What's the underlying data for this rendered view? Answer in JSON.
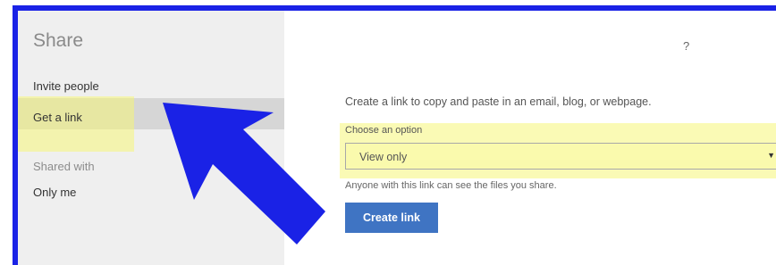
{
  "sidebar": {
    "title": "Share",
    "items": [
      {
        "label": "Invite people"
      },
      {
        "label": "Get a link"
      }
    ],
    "shared_with_label": "Shared with",
    "shared_with_value": "Only me"
  },
  "main": {
    "help_glyph": "?",
    "description": "Create a link to copy and paste in an email, blog, or webpage.",
    "choose_label": "Choose an option",
    "select_value": "View only",
    "note": "Anyone with this link can see the files you share.",
    "create_label": "Create link"
  },
  "colors": {
    "frame": "#1a22e6",
    "highlight": "#f5f578",
    "button": "#3f74c3",
    "sidebar_bg": "#efefef",
    "selected_bg": "#d6d6d6"
  }
}
